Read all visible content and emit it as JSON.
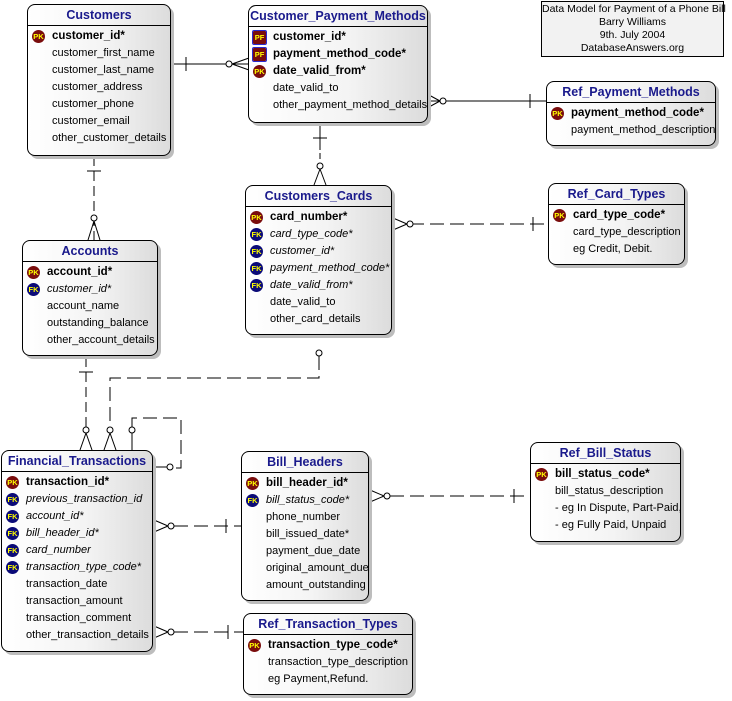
{
  "note": {
    "lines": [
      "Data Model for Payment of a Phone Bill",
      "Barry Williams",
      "9th. July 2004",
      "DatabaseAnswers.org"
    ]
  },
  "entities": {
    "customers": {
      "title": "Customers",
      "rows": [
        {
          "text": "customer_id*",
          "key": "PK"
        },
        {
          "text": "customer_first_name",
          "key": ""
        },
        {
          "text": "customer_last_name",
          "key": ""
        },
        {
          "text": "customer_address",
          "key": ""
        },
        {
          "text": "customer_phone",
          "key": ""
        },
        {
          "text": "customer_email",
          "key": ""
        },
        {
          "text": "other_customer_details",
          "key": ""
        }
      ]
    },
    "customer_payment_methods": {
      "title": "Customer_Payment_Methods",
      "rows": [
        {
          "text": "customer_id*",
          "key": "PF"
        },
        {
          "text": "payment_method_code*",
          "key": "PF"
        },
        {
          "text": "date_valid_from*",
          "key": "PK"
        },
        {
          "text": "date_valid_to",
          "key": ""
        },
        {
          "text": "other_payment_method_details",
          "key": ""
        }
      ]
    },
    "ref_payment_methods": {
      "title": "Ref_Payment_Methods",
      "rows": [
        {
          "text": "payment_method_code*",
          "key": "PK"
        },
        {
          "text": "payment_method_description",
          "key": ""
        }
      ]
    },
    "accounts": {
      "title": "Accounts",
      "rows": [
        {
          "text": "account_id*",
          "key": "PK"
        },
        {
          "text": "customer_id*",
          "key": "FK"
        },
        {
          "text": "account_name",
          "key": ""
        },
        {
          "text": "outstanding_balance",
          "key": ""
        },
        {
          "text": "other_account_details",
          "key": ""
        }
      ]
    },
    "customers_cards": {
      "title": "Customers_Cards",
      "rows": [
        {
          "text": "card_number*",
          "key": "PK"
        },
        {
          "text": "card_type_code*",
          "key": "FK"
        },
        {
          "text": "customer_id*",
          "key": "FK"
        },
        {
          "text": "payment_method_code*",
          "key": "FK"
        },
        {
          "text": "date_valid_from*",
          "key": "FK"
        },
        {
          "text": "date_valid_to",
          "key": ""
        },
        {
          "text": "other_card_details",
          "key": ""
        }
      ]
    },
    "ref_card_types": {
      "title": "Ref_Card_Types",
      "rows": [
        {
          "text": "card_type_code*",
          "key": "PK"
        },
        {
          "text": "card_type_description",
          "key": ""
        },
        {
          "text": "eg Credit, Debit.",
          "key": ""
        }
      ]
    },
    "financial_transactions": {
      "title": "Financial_Transactions",
      "rows": [
        {
          "text": "transaction_id*",
          "key": "PK"
        },
        {
          "text": "previous_transaction_id",
          "key": "FK"
        },
        {
          "text": "account_id*",
          "key": "FK"
        },
        {
          "text": "bill_header_id*",
          "key": "FK"
        },
        {
          "text": "card_number",
          "key": "FK"
        },
        {
          "text": "transaction_type_code*",
          "key": "FK"
        },
        {
          "text": "transaction_date",
          "key": ""
        },
        {
          "text": "transaction_amount",
          "key": ""
        },
        {
          "text": "transaction_comment",
          "key": ""
        },
        {
          "text": "other_transaction_details",
          "key": ""
        }
      ]
    },
    "bill_headers": {
      "title": "Bill_Headers",
      "rows": [
        {
          "text": "bill_header_id*",
          "key": "PK"
        },
        {
          "text": "bill_status_code*",
          "key": "FK"
        },
        {
          "text": "phone_number",
          "key": ""
        },
        {
          "text": "bill_issued_date*",
          "key": ""
        },
        {
          "text": "payment_due_date",
          "key": ""
        },
        {
          "text": "original_amount_due",
          "key": ""
        },
        {
          "text": "amount_outstanding",
          "key": ""
        }
      ]
    },
    "ref_bill_status": {
      "title": "Ref_Bill_Status",
      "rows": [
        {
          "text": "bill_status_code*",
          "key": "PK"
        },
        {
          "text": "bill_status_description",
          "key": ""
        },
        {
          "text": "- eg In Dispute, Part-Paid,",
          "key": ""
        },
        {
          "text": "- eg Fully Paid, Unpaid",
          "key": ""
        }
      ]
    },
    "ref_transaction_types": {
      "title": "Ref_Transaction_Types",
      "rows": [
        {
          "text": "transaction_type_code*",
          "key": "PK"
        },
        {
          "text": "transaction_type_description",
          "key": ""
        },
        {
          "text": "eg Payment,Refund.",
          "key": ""
        }
      ]
    }
  },
  "relationships": [
    {
      "from": "customers",
      "to": "customer_payment_methods",
      "style": "solid",
      "cardinality": "one-to-many"
    },
    {
      "from": "ref_payment_methods",
      "to": "customer_payment_methods",
      "style": "solid",
      "cardinality": "one-to-many"
    },
    {
      "from": "customer_payment_methods",
      "to": "customers_cards",
      "style": "dashed",
      "cardinality": "one-to-many"
    },
    {
      "from": "customers",
      "to": "accounts",
      "style": "dashed",
      "cardinality": "one-to-many"
    },
    {
      "from": "ref_card_types",
      "to": "customers_cards",
      "style": "dashed",
      "cardinality": "one-to-many"
    },
    {
      "from": "accounts",
      "to": "financial_transactions",
      "style": "dashed",
      "cardinality": "one-to-many"
    },
    {
      "from": "customers_cards",
      "to": "financial_transactions",
      "style": "dashed",
      "cardinality": "zero-or-one-to-many"
    },
    {
      "from": "financial_transactions",
      "to": "financial_transactions",
      "style": "dashed",
      "cardinality": "self"
    },
    {
      "from": "bill_headers",
      "to": "financial_transactions",
      "style": "dashed",
      "cardinality": "one-to-many"
    },
    {
      "from": "ref_bill_status",
      "to": "bill_headers",
      "style": "dashed",
      "cardinality": "one-to-many"
    },
    {
      "from": "ref_transaction_types",
      "to": "financial_transactions",
      "style": "dashed",
      "cardinality": "one-to-many"
    }
  ]
}
